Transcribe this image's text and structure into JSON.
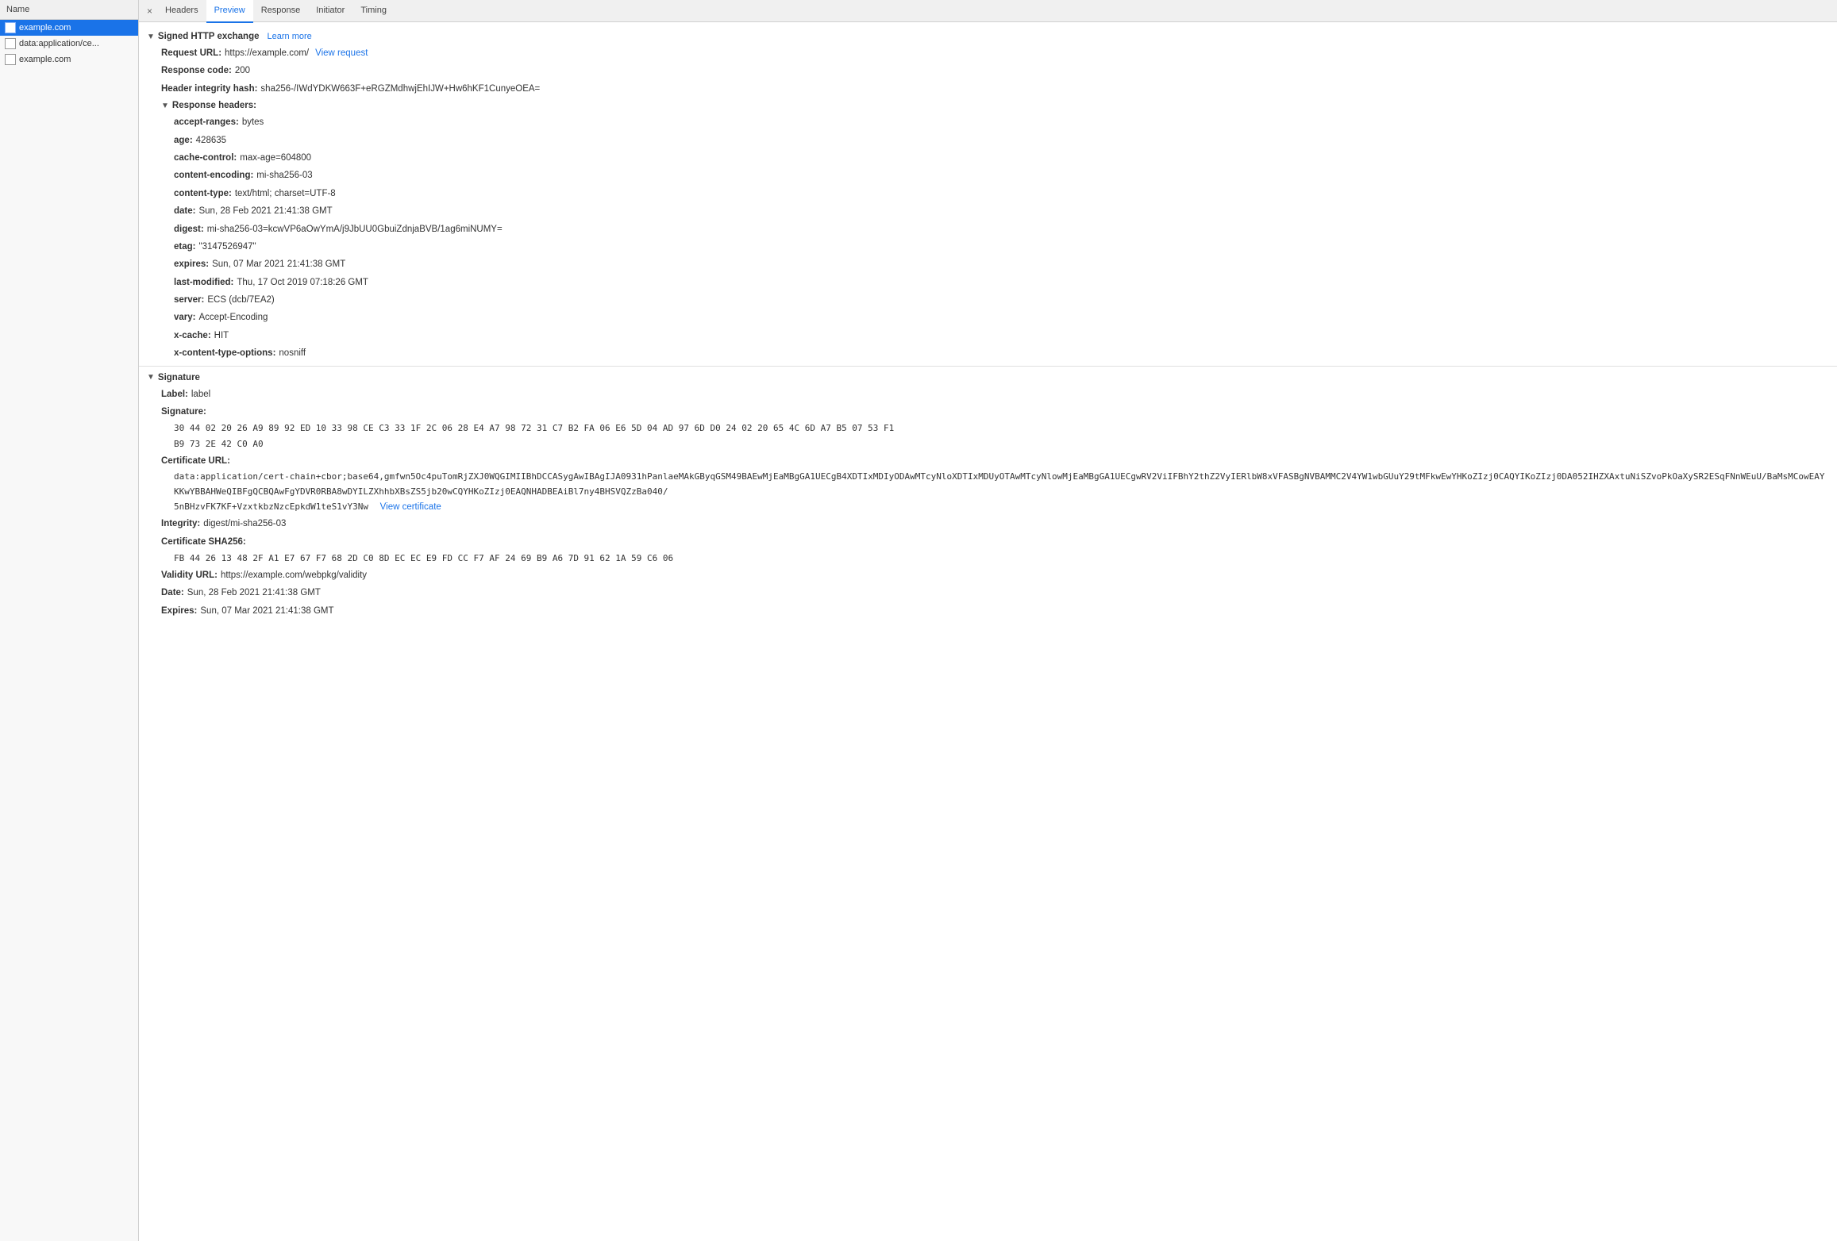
{
  "leftPanel": {
    "header": "Name",
    "items": [
      {
        "id": "example-com-1",
        "label": "example.com",
        "active": true
      },
      {
        "id": "data-application",
        "label": "data:application/ce...",
        "active": false
      },
      {
        "id": "example-com-2",
        "label": "example.com",
        "active": false
      }
    ]
  },
  "tabs": {
    "closeSymbol": "×",
    "items": [
      {
        "id": "headers",
        "label": "Headers",
        "active": false
      },
      {
        "id": "preview",
        "label": "Preview",
        "active": true
      },
      {
        "id": "response",
        "label": "Response",
        "active": false
      },
      {
        "id": "initiator",
        "label": "Initiator",
        "active": false
      },
      {
        "id": "timing",
        "label": "Timing",
        "active": false
      }
    ]
  },
  "signedExchange": {
    "sectionLabel": "Signed HTTP exchange",
    "learnMoreLabel": "Learn more",
    "requestURL": {
      "label": "Request URL:",
      "value": "https://example.com/",
      "linkLabel": "View request"
    },
    "responseCode": {
      "label": "Response code:",
      "value": "200"
    },
    "headerIntegrityHash": {
      "label": "Header integrity hash:",
      "value": "sha256-/IWdYDKW663F+eRGZMdhwjEhIJW+Hw6hKF1CunyeOEA="
    },
    "responseHeaders": {
      "sectionLabel": "Response headers:",
      "fields": [
        {
          "label": "accept-ranges:",
          "value": "bytes"
        },
        {
          "label": "age:",
          "value": "428635"
        },
        {
          "label": "cache-control:",
          "value": "max-age=604800"
        },
        {
          "label": "content-encoding:",
          "value": "mi-sha256-03"
        },
        {
          "label": "content-type:",
          "value": "text/html; charset=UTF-8"
        },
        {
          "label": "date:",
          "value": "Sun, 28 Feb 2021 21:41:38 GMT"
        },
        {
          "label": "digest:",
          "value": "mi-sha256-03=kcwVP6aOwYmA/j9JbUU0GbuiZdnjaBVB/1ag6miNUMY="
        },
        {
          "label": "etag:",
          "value": "\"3147526947\""
        },
        {
          "label": "expires:",
          "value": "Sun, 07 Mar 2021 21:41:38 GMT"
        },
        {
          "label": "last-modified:",
          "value": "Thu, 17 Oct 2019 07:18:26 GMT"
        },
        {
          "label": "server:",
          "value": "ECS (dcb/7EA2)"
        },
        {
          "label": "vary:",
          "value": "Accept-Encoding"
        },
        {
          "label": "x-cache:",
          "value": "HIT"
        },
        {
          "label": "x-content-type-options:",
          "value": "nosniff"
        }
      ]
    }
  },
  "signature": {
    "sectionLabel": "Signature",
    "label": {
      "label": "Label:",
      "value": "label"
    },
    "signatureLabel": "Signature:",
    "signatureHex1": "30 44 02 20 26 A9 89 92 ED 10 33 98 CE C3 33 1F 2C 06 28 E4 A7 98 72 31 C7 B2 FA 06 E6 5D 04 AD 97 6D D0 24 02 20 65 4C 6D A7 B5 07 53 F1",
    "signatureHex2": "B9 73 2E 42 C0 A0",
    "certificateURL": {
      "label": "Certificate URL:",
      "value1": "data:application/cert-chain+cbor;base64,gmfwn5Oc4puTomRjZXJ0WQGIMIIBhDCCASygAwIBAgIJA0931hPanlaeMAkGByqGSM49BAEwMjEaMBgGA1UECg",
      "value2": "B4XDTIxMDIyODAwMTcyNloXDTIxMDUyOTAwMTcyNlowMjEaMBgGA1UECgwRV2ViIFBhY2thZ2VyIERlbW8xVFASBgNVBAMMC2V4YW1wbGUuY29tMFkwEwYHKoZIzj0CAQYIKoZIzj0DA0",
      "value3": "52IHZXAxtuNiSZvoPkOaXySR2ESqFNnWEuU/BaMsMCowEAYKKwYBBAHWeQIBFgQCBQAwFgYDVR0RBA8wDYILZXhhbXBsZS5jb20wCQYHKoZIzj0EAQNHADBEAiBl7ny4BHSVQZzBa040/",
      "value4": "5nBHzvFK7KF+VzxtkbzNzcEpkdW1teS1vY3Nw",
      "viewCertLabel": "View certificate"
    },
    "integrity": {
      "label": "Integrity:",
      "value": "digest/mi-sha256-03"
    },
    "certSHA256": {
      "label": "Certificate SHA256:",
      "value": "FB 44 26 13 48 2F A1 E7 67 F7 68 2D C0 8D EC EC E9 FD CC F7 AF 24 69 B9 A6 7D 91 62 1A 59 C6 06"
    },
    "validityURL": {
      "label": "Validity URL:",
      "value": "https://example.com/webpkg/validity"
    },
    "date": {
      "label": "Date:",
      "value": "Sun, 28 Feb 2021 21:41:38 GMT"
    },
    "expires": {
      "label": "Expires:",
      "value": "Sun, 07 Mar 2021 21:41:38 GMT"
    }
  }
}
